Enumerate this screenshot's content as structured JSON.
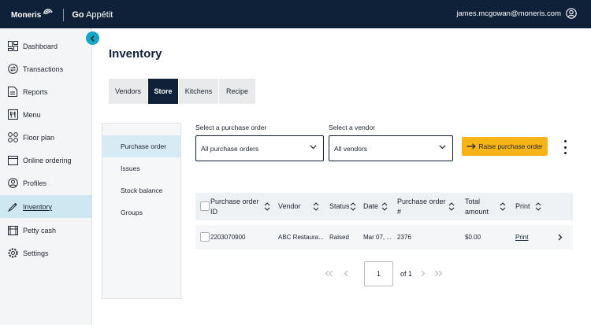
{
  "header": {
    "brand_name": "Moneris",
    "product_prefix": "Go",
    "product_name": "Appétit",
    "user_email": "james.mcgowan@moneris.com"
  },
  "sidebar": {
    "items": [
      {
        "label": "Dashboard",
        "icon": "dashboard-icon"
      },
      {
        "label": "Transactions",
        "icon": "transactions-icon"
      },
      {
        "label": "Reports",
        "icon": "reports-icon"
      },
      {
        "label": "Menu",
        "icon": "menu-icon"
      },
      {
        "label": "Floor plan",
        "icon": "floor-plan-icon"
      },
      {
        "label": "Online ordering",
        "icon": "online-ordering-icon"
      },
      {
        "label": "Profiles",
        "icon": "profiles-icon"
      },
      {
        "label": "Inventory",
        "icon": "inventory-icon",
        "active": true
      },
      {
        "label": "Petty cash",
        "icon": "petty-cash-icon"
      },
      {
        "label": "Settings",
        "icon": "settings-icon"
      }
    ]
  },
  "main": {
    "title": "Inventory",
    "tabs": [
      {
        "label": "Vendors"
      },
      {
        "label": "Store",
        "active": true
      },
      {
        "label": "Kitchens"
      },
      {
        "label": "Recipe"
      }
    ],
    "subnav": [
      {
        "label": "Purchase order",
        "active": true
      },
      {
        "label": "Issues"
      },
      {
        "label": "Stock balance"
      },
      {
        "label": "Groups"
      }
    ],
    "filters": {
      "purchase_order_label": "Select a purchase order",
      "purchase_order_value": "All purchase orders",
      "vendor_label": "Select a vendor",
      "vendor_value": "All vendors"
    },
    "raise_button_label": "Raise purchase order",
    "table": {
      "columns": [
        {
          "line1": "Purchase order",
          "line2": "ID"
        },
        {
          "line1": "Vendor",
          "line2": ""
        },
        {
          "line1": "Status",
          "line2": ""
        },
        {
          "line1": "Date",
          "line2": ""
        },
        {
          "line1": "Purchase order",
          "line2": "#"
        },
        {
          "line1": "Total",
          "line2": "amount"
        },
        {
          "line1": "Print",
          "line2": ""
        }
      ],
      "rows": [
        {
          "id": "2203070900",
          "vendor": "ABC Restaura...",
          "status": "Raised",
          "date": "Mar 07, ...",
          "po_number": "2376",
          "total": "$0.00",
          "print": "Print"
        }
      ]
    },
    "pagination": {
      "current_page": "1",
      "of_label": "of 1"
    }
  },
  "colors": {
    "header_bg": "#0f2139",
    "accent_teal": "#16a5c4",
    "active_nav_bg": "#cfe7f1",
    "raise_button_bg": "#f7b416"
  }
}
